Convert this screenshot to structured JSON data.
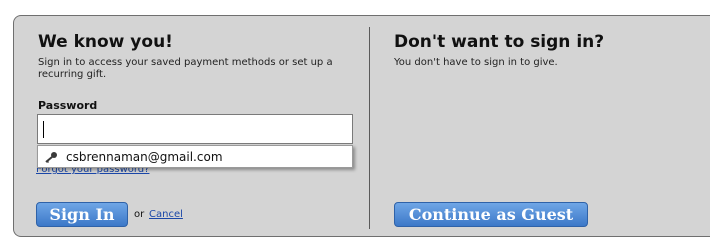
{
  "signin": {
    "heading": "We know you!",
    "description": "Sign in to access your saved payment methods or set up a recurring gift.",
    "password_label": "Password",
    "password_value": "",
    "autocomplete_option": "csbrennaman@gmail.com",
    "forgot_link": "Forgot your password?",
    "signin_button": "Sign In",
    "or_text": "or",
    "cancel_link": "Cancel"
  },
  "guest": {
    "heading": "Don't want to sign in?",
    "description": "You don't have to sign in to give.",
    "continue_button": "Continue as Guest"
  },
  "icons": {
    "autocomplete_icon": "key-icon"
  },
  "colors": {
    "panel_bg": "#d4d4d4",
    "button_blue": "#3c78c8",
    "link_blue": "#1a47a8"
  }
}
